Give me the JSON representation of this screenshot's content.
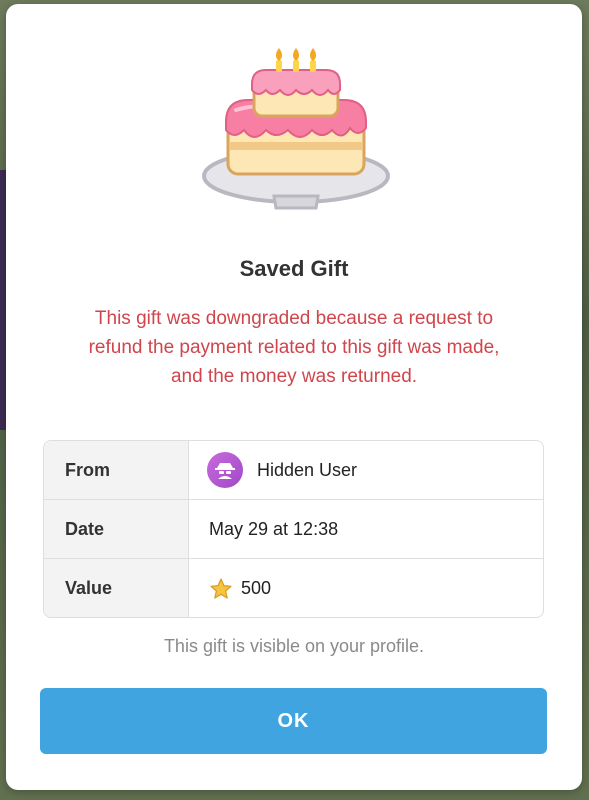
{
  "dialog": {
    "title": "Saved Gift",
    "warning": "This gift was downgraded because a request to refund the payment related to this gift was made, and the money was returned.",
    "details": {
      "from_label": "From",
      "from_value": "Hidden User",
      "date_label": "Date",
      "date_value": "May 29 at 12:38",
      "value_label": "Value",
      "value_amount": "500"
    },
    "footnote": "This gift is visible on your profile.",
    "ok_label": "OK"
  },
  "icons": {
    "gift": "birthday-cake-icon",
    "avatar": "hidden-user-icon",
    "value": "star-icon"
  },
  "colors": {
    "accent": "#3fa4e0",
    "warning": "#d0454c",
    "avatar": "#b25ad3",
    "star": "#f5c542"
  }
}
